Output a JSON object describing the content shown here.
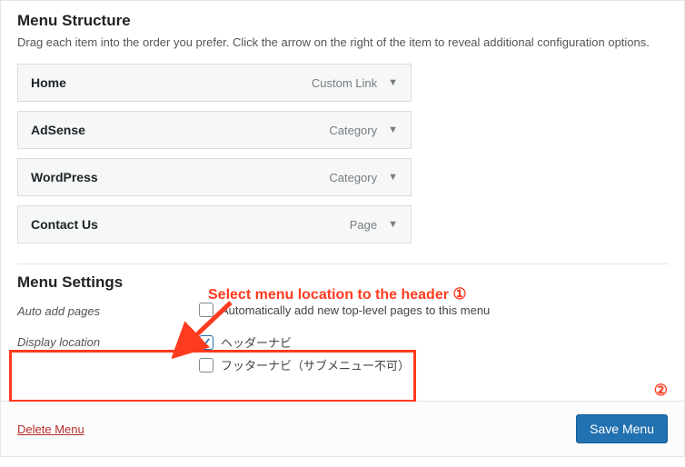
{
  "structure": {
    "heading": "Menu Structure",
    "description": "Drag each item into the order you prefer. Click the arrow on the right of the item to reveal additional configuration options.",
    "items": [
      {
        "title": "Home",
        "type": "Custom Link"
      },
      {
        "title": "AdSense",
        "type": "Category"
      },
      {
        "title": "WordPress",
        "type": "Category"
      },
      {
        "title": "Contact Us",
        "type": "Page"
      }
    ]
  },
  "settings": {
    "heading": "Menu Settings",
    "auto_add": {
      "label": "Auto add pages",
      "option": "Automatically add new top-level pages to this menu"
    },
    "display": {
      "label": "Display location",
      "options": [
        {
          "text": "ヘッダーナビ",
          "checked": true
        },
        {
          "text": "フッターナビ（サブメニュー不可）",
          "checked": false
        }
      ]
    }
  },
  "footer": {
    "delete": "Delete Menu",
    "save": "Save Menu"
  },
  "annot": {
    "text": "Select menu location to the header",
    "num1": "①",
    "num2": "②"
  }
}
